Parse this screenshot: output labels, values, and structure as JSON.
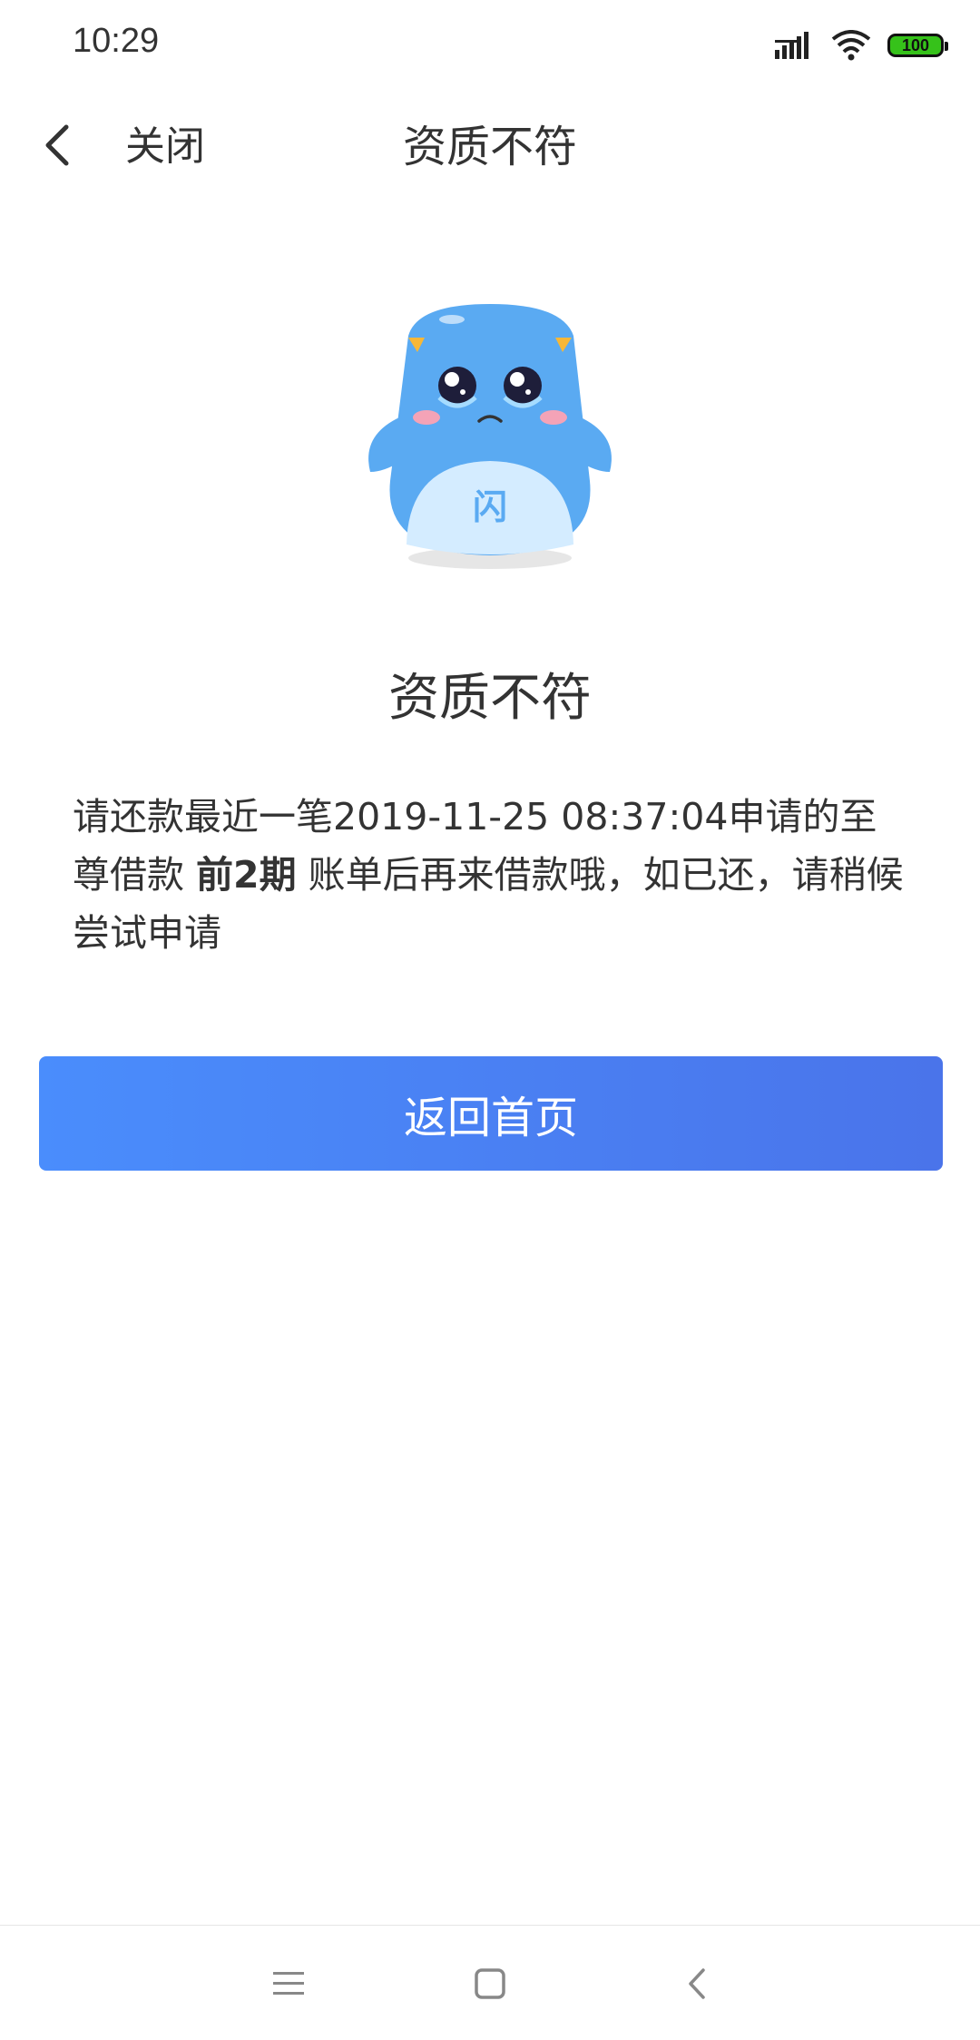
{
  "status_bar": {
    "time": "10:29",
    "battery": "100",
    "icons": [
      "signal-icon",
      "wifi-icon",
      "battery-icon"
    ]
  },
  "nav": {
    "back_icon": "chevron-left-icon",
    "close_label": "关闭",
    "title": "资质不符"
  },
  "result": {
    "mascot": "sad-mascot-illustration",
    "mascot_badge": "闪",
    "title": "资质不符",
    "message_part1": "请还款最近一笔2019-11-25 08:37:04申请的至尊借款 ",
    "message_bold": "前2期",
    "message_part2": " 账单后再来借款哦，如已还，请稍候尝试申请"
  },
  "actions": {
    "home_button_label": "返回首页"
  },
  "system_nav": {
    "icons": [
      "menu-icon",
      "home-square-icon",
      "back-chevron-icon"
    ]
  },
  "colors": {
    "primary_gradient_start": "#4a8dfc",
    "primary_gradient_end": "#4a74ea",
    "mascot_blue": "#5aaaf2",
    "battery_green": "#36c21a"
  }
}
